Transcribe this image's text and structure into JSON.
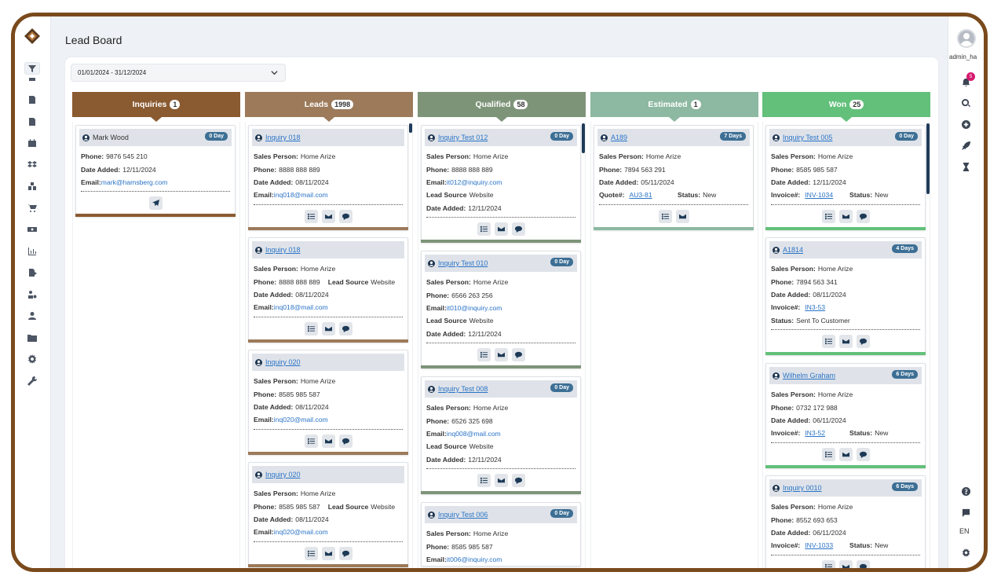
{
  "app": {
    "title": "Lead Board",
    "username": "admin_ha",
    "notifications": "5",
    "language": "EN"
  },
  "filter": {
    "date_range": "01/01/2024 - 31/12/2024"
  },
  "colors": {
    "inquiries": "#8a5a30",
    "leads": "#9c7a5a",
    "qualified": "#7e9479",
    "estimated": "#8db8a1",
    "won": "#62c07a",
    "day_badge": "#3d6f95",
    "link": "#2b74c7"
  },
  "columns": {
    "inquiries": {
      "title": "Inquiries",
      "count": "1"
    },
    "leads": {
      "title": "Leads",
      "count": "1998"
    },
    "qualified": {
      "title": "Qualified",
      "count": "58"
    },
    "estimated": {
      "title": "Estimated",
      "count": "1"
    },
    "won": {
      "title": "Won",
      "count": "25"
    }
  },
  "labels": {
    "phone": "Phone:",
    "date_added": "Date Added:",
    "email": "Email:",
    "sales_person": "Sales Person:",
    "lead_source": "Lead Source",
    "quote": "Quote#:",
    "invoice": "Invoice#:",
    "status": "Status:"
  },
  "cards": {
    "inq1": {
      "name": "Mark Wood",
      "days": "0 Day",
      "phone": "9876 545 210",
      "date": "12/11/2024",
      "email": "mark@hamsberg.com"
    },
    "lead1": {
      "name": "Inquiry 018",
      "sales": "Home Arize",
      "phone": "8888 888 889",
      "date": "08/11/2024",
      "email": "inq018@mail.com"
    },
    "lead2": {
      "name": "Inquiry 018",
      "sales": "Home Arize",
      "phone": "8888 888 889",
      "source": "Website",
      "date": "08/11/2024",
      "email": "inq018@mail.com"
    },
    "lead3": {
      "name": "Inquiry 020",
      "sales": "Home Arize",
      "phone": "8585 985 587",
      "date": "08/11/2024",
      "email": "inq020@mail.com"
    },
    "lead4": {
      "name": "Inquiry 020",
      "sales": "Home Arize",
      "phone": "8585 985 587",
      "source": "Website",
      "date": "08/11/2024",
      "email": "inq020@mail.com"
    },
    "qual1": {
      "name": "Inquiry Test 012",
      "days": "0 Day",
      "sales": "Home Arize",
      "phone": "8888 888 889",
      "email": "it012@inquiry.com",
      "source": "Website",
      "date": "12/11/2024"
    },
    "qual2": {
      "name": "Inquiry Test 010",
      "days": "0 Day",
      "sales": "Home Arize",
      "phone": "6566 263 256",
      "email": "it010@inquiry.com",
      "source": "Website",
      "date": "12/11/2024"
    },
    "qual3": {
      "name": "Inquiry Test 008",
      "days": "0 Day",
      "sales": "Home Arize",
      "phone": "6526 325 698",
      "email": "inq008@mail.com",
      "source": "Website",
      "date": "12/11/2024"
    },
    "qual4": {
      "name": "Inquiry Test 006",
      "days": "0 Day",
      "sales": "Home Arize",
      "phone": "8585 985 587",
      "email": "it006@inquiry.com"
    },
    "est1": {
      "name": "A189",
      "days": "7 Days",
      "sales": "Home Arize",
      "phone": "7894 563 291",
      "date": "05/11/2024",
      "quote": "AU3-81",
      "status": "New"
    },
    "won1": {
      "name": "Inquiry Test 005",
      "days": "0 Day",
      "sales": "Home Arize",
      "phone": "8585 985 587",
      "date": "12/11/2024",
      "invoice": "INV-1034",
      "status": "New"
    },
    "won2": {
      "name": "A1814",
      "days": "4 Days",
      "sales": "Home Arize",
      "phone": "7894 563 341",
      "date": "08/11/2024",
      "invoice": "IN3-53",
      "status": "Sent To Customer"
    },
    "won3": {
      "name": "Wilhelm Graham",
      "days": "6 Days",
      "sales": "Home Arize",
      "phone": "0732 172 988",
      "date": "06/11/2024",
      "invoice": "IN3-52",
      "status": "New"
    },
    "won4": {
      "name": "Inquiry 0010",
      "days": "6 Days",
      "sales": "Home Arize",
      "phone": "8552 693 653",
      "date": "06/11/2024",
      "invoice": "INV-1033",
      "status": "New"
    }
  }
}
